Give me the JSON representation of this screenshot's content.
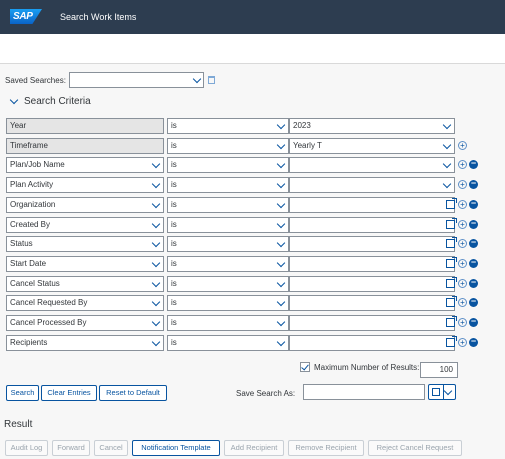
{
  "header": {
    "logo": "SAP",
    "title": "Search Work Items"
  },
  "saved_searches": {
    "label": "Saved Searches:",
    "value": ""
  },
  "criteria": {
    "title": "Search Criteria",
    "rows": [
      {
        "field": "Year",
        "op": "is",
        "value": "2023"
      },
      {
        "field": "Timeframe",
        "op": "is",
        "value": "Yearly T"
      },
      {
        "field": "Plan/Job Name",
        "op": "is",
        "value": ""
      },
      {
        "field": "Plan Activity",
        "op": "is",
        "value": ""
      },
      {
        "field": "Organization",
        "op": "is",
        "value": ""
      },
      {
        "field": "Created By",
        "op": "is",
        "value": ""
      },
      {
        "field": "Status",
        "op": "is",
        "value": ""
      },
      {
        "field": "Start Date",
        "op": "is",
        "value": ""
      },
      {
        "field": "Cancel Status",
        "op": "is",
        "value": ""
      },
      {
        "field": "Cancel Requested By",
        "op": "is",
        "value": ""
      },
      {
        "field": "Cancel Processed By",
        "op": "is",
        "value": ""
      },
      {
        "field": "Recipients",
        "op": "is",
        "value": ""
      }
    ]
  },
  "max_results": {
    "label": "Maximum Number of Results:",
    "value": "100",
    "checked": true
  },
  "actions": {
    "search": "Search",
    "clear": "Clear Entries",
    "reset": "Reset to Default",
    "save_label": "Save Search As:"
  },
  "result": {
    "title": "Result",
    "toolbar": [
      "Audit Log",
      "Forward",
      "Cancel",
      "Notification Template",
      "Add Recipient",
      "Remove Recipient",
      "Reject Cancel Request"
    ]
  }
}
